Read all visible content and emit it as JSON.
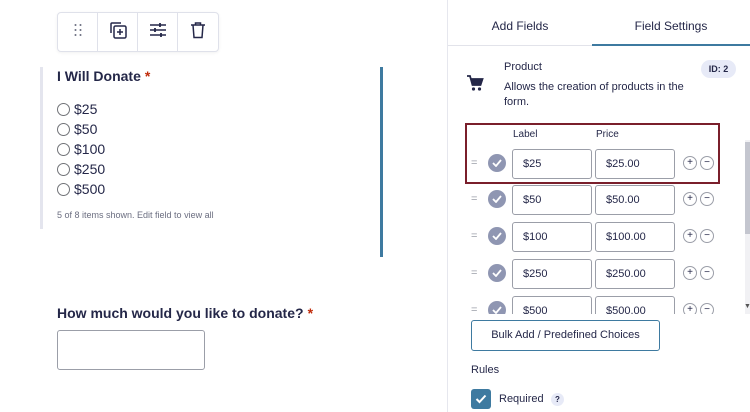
{
  "canvas": {
    "toolbar": {
      "icons": [
        "drag-dots-icon",
        "duplicate-icon",
        "settings-sliders-icon",
        "trash-icon"
      ]
    },
    "field1": {
      "label": "I Will Donate",
      "required_mark": "*",
      "options": [
        "$25",
        "$50",
        "$100",
        "$250",
        "$500"
      ],
      "note": "5 of 8 items shown. Edit field to view all"
    },
    "field2": {
      "label": "How much would you like to donate?",
      "required_mark": "*",
      "value": ""
    }
  },
  "panel": {
    "tabs": [
      {
        "label": "Add Fields",
        "active": false
      },
      {
        "label": "Field Settings",
        "active": true
      }
    ],
    "product": {
      "title": "Product",
      "description": "Allows the creation of products in the form.",
      "id_badge": "ID: 2",
      "icon": "cart-icon"
    },
    "choices": {
      "label_header": "Label",
      "price_header": "Price",
      "handle_glyph": "=",
      "plus_glyph": "+",
      "minus_glyph": "−",
      "rows": [
        {
          "label": "$25",
          "price": "$25.00"
        },
        {
          "label": "$50",
          "price": "$50.00"
        },
        {
          "label": "$100",
          "price": "$100.00"
        },
        {
          "label": "$250",
          "price": "$250.00"
        },
        {
          "label": "$500",
          "price": "$500.00"
        }
      ]
    },
    "bulk_button": "Bulk Add / Predefined Choices",
    "rules": {
      "heading": "Rules",
      "required_label": "Required",
      "required_checked": true,
      "help_glyph": "?"
    }
  },
  "colors": {
    "accent": "#3e7aa0",
    "required": "#c02b0a",
    "highlight_box": "#7a1f2b",
    "check_circle": "#8f96b2"
  }
}
